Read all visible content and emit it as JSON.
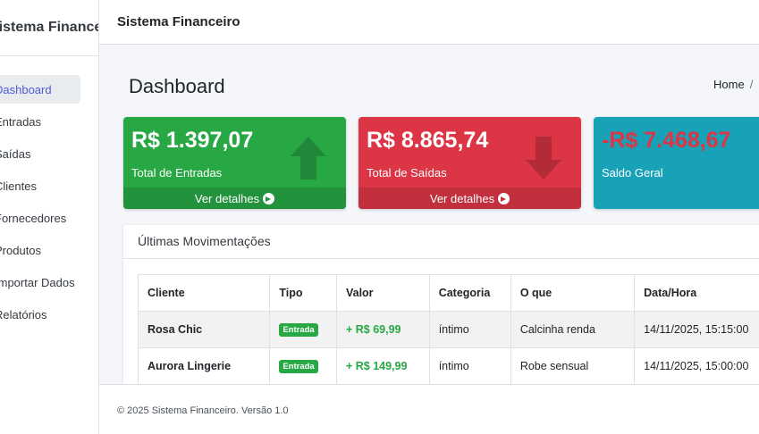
{
  "sidebar": {
    "brand": "Sistema Financeiro",
    "items": [
      {
        "label": "Dashboard",
        "active": true
      },
      {
        "label": "Entradas"
      },
      {
        "label": "Saídas"
      },
      {
        "label": "Clientes"
      },
      {
        "label": "Fornecedores"
      },
      {
        "label": "Produtos"
      },
      {
        "label": "Importar Dados"
      },
      {
        "label": "Relatórios"
      }
    ]
  },
  "header": {
    "title": "Sistema Financeiro"
  },
  "main": {
    "page_title": "Dashboard",
    "breadcrumb": {
      "home": "Home",
      "separator": "/"
    },
    "cards": [
      {
        "amount": "R$ 1.397,07",
        "label": "Total de Entradas",
        "footer": "Ver detalhes",
        "color": "#28a745",
        "icon": "arrow-up-icon"
      },
      {
        "amount": "R$ 8.865,74",
        "label": "Total de Saídas",
        "footer": "Ver detalhes",
        "color": "#dc3545",
        "icon": "arrow-down-icon"
      },
      {
        "amount": "-R$ 7.468,67",
        "label": "Saldo Geral",
        "color": "#17a2b8",
        "icon": "balance-scale-icon"
      }
    ],
    "movements": {
      "title": "Últimas Movimentações",
      "columns": [
        "Cliente",
        "Tipo",
        "Valor",
        "Categoria",
        "O que",
        "Data/Hora"
      ],
      "rows": [
        {
          "cliente": "Rosa Chic",
          "tipo": "Entrada",
          "valor": "+ R$ 69,99",
          "categoria": "íntimo",
          "o_que": "Calcinha renda",
          "data_hora": "14/11/2025, 15:15:00"
        },
        {
          "cliente": "Aurora Lingerie",
          "tipo": "Entrada",
          "valor": "+ R$ 149,99",
          "categoria": "íntimo",
          "o_que": "Robe sensual",
          "data_hora": "14/11/2025, 15:00:00"
        }
      ]
    }
  },
  "footer": {
    "copyright": "© 2025 Sistema Financeiro. Versão 1.0"
  },
  "colors": {
    "success": "#28a745",
    "danger": "#dc3545",
    "info": "#17a2b8",
    "active_nav": "#4e5bd6"
  }
}
